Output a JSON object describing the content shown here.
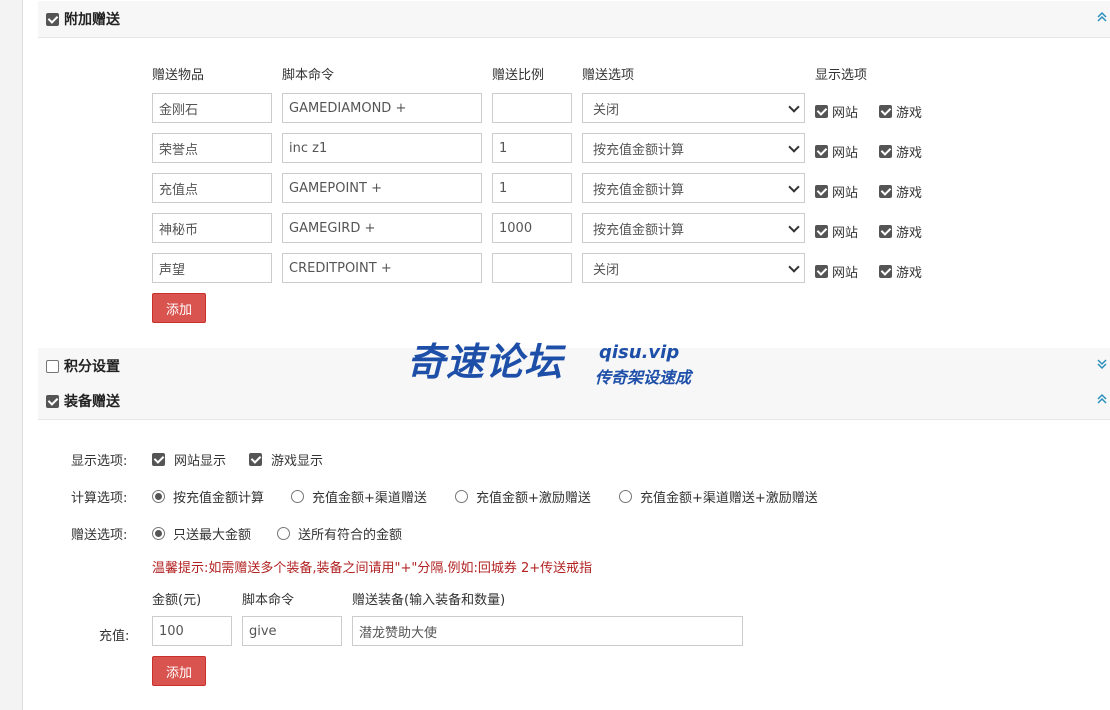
{
  "section_extra": {
    "title": "附加赠送",
    "checked": true,
    "headers": [
      "赠送物品",
      "脚本命令",
      "赠送比例",
      "赠送选项",
      "显示选项"
    ],
    "rows": [
      {
        "item": "金刚石",
        "cmd": "GAMEDIAMOND +",
        "ratio": "",
        "option": "关闭",
        "web": "网站",
        "game": "游戏"
      },
      {
        "item": "荣誉点",
        "cmd": "inc  z1",
        "ratio": "1",
        "option": "按充值金额计算",
        "web": "网站",
        "game": "游戏"
      },
      {
        "item": "充值点",
        "cmd": "GAMEPOINT +",
        "ratio": "1",
        "option": "按充值金额计算",
        "web": "网站",
        "game": "游戏"
      },
      {
        "item": "神秘币",
        "cmd": "GAMEGIRD +",
        "ratio": "1000",
        "option": "按充值金额计算",
        "web": "网站",
        "game": "游戏"
      },
      {
        "item": "声望",
        "cmd": "CREDITPOINT +",
        "ratio": "",
        "option": "关闭",
        "web": "网站",
        "game": "游戏"
      }
    ],
    "add_label": "添加"
  },
  "section_points": {
    "title": "积分设置",
    "checked": false
  },
  "watermark": {
    "main": "奇速论坛",
    "site": "qisu.vip",
    "slogan": "传奇架设速成"
  },
  "section_equip": {
    "title": "装备赠送",
    "checked": true,
    "display_label": "显示选项:",
    "display_web": "网站显示",
    "display_game": "游戏显示",
    "calc_label": "计算选项:",
    "calc_options": [
      "按充值金额计算",
      "充值金额+渠道赠送",
      "充值金额+激励赠送",
      "充值金额+渠道赠送+激励赠送"
    ],
    "calc_selected": 0,
    "gift_label": "赠送选项:",
    "gift_options": [
      "只送最大金额",
      "送所有符合的金额"
    ],
    "gift_selected": 0,
    "tip": "温馨提示:如需赠送多个装备,装备之间请用\"+\"分隔.例如:回城券 2+传送戒指",
    "col_amount": "金额(元)",
    "col_cmd": "脚本命令",
    "col_equip": "赠送装备(输入装备和数量)",
    "recharge_label": "充值:",
    "amount": "100",
    "cmd": "give",
    "equip": "潜龙赞助大使",
    "add_label": "添加"
  }
}
